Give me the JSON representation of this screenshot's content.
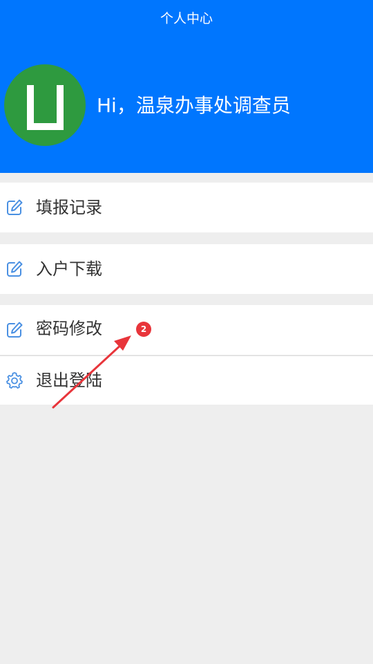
{
  "header": {
    "title": "个人中心",
    "greeting": "Hi，温泉办事处调查员",
    "background_color": "#0076fe"
  },
  "avatar": {
    "background_color": "#2e9a3f",
    "icon": "u-logo-icon"
  },
  "menu": {
    "items": [
      {
        "label": "填报记录",
        "icon": "edit-icon"
      },
      {
        "label": "入户下载",
        "icon": "edit-icon"
      },
      {
        "label": "密码修改",
        "icon": "edit-icon"
      },
      {
        "label": "退出登陆",
        "icon": "gear-icon"
      }
    ],
    "icon_color": "#4a90e2"
  },
  "annotation": {
    "badge_text": "2",
    "badge_color": "#e8353b",
    "arrow_color": "#e8353b"
  }
}
